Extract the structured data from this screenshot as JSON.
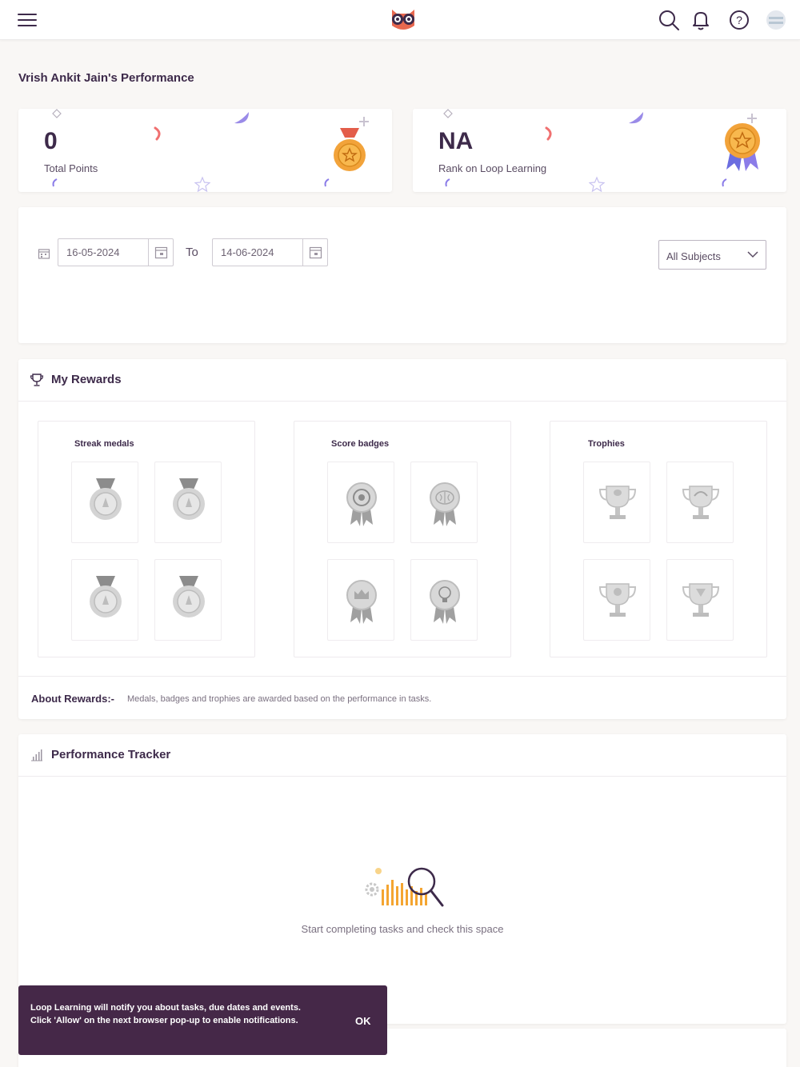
{
  "header": {
    "menu_icon": "hamburger-icon",
    "logo_icon": "owl-logo-icon",
    "actions": [
      "search-icon",
      "bell-icon",
      "help-icon",
      "avatar"
    ]
  },
  "page": {
    "title": "Vrish Ankit Jain's  Performance"
  },
  "stats": [
    {
      "value": "0",
      "label": "Total Points",
      "icon": "medal-icon"
    },
    {
      "value": "NA",
      "label": "Rank on Loop Learning",
      "icon": "rosette-icon"
    }
  ],
  "filters": {
    "calendar_icon": "calendar-icon",
    "from_date": "16-05-2024",
    "to_label": "To",
    "to_date": "14-06-2024",
    "subject": "All Subjects"
  },
  "rewards": {
    "title": "My Rewards",
    "panels": [
      {
        "title": "Streak medals",
        "items": [
          "medal-icon",
          "medal-icon",
          "medal-icon",
          "medal-icon"
        ]
      },
      {
        "title": "Score badges",
        "items": [
          "target-badge-icon",
          "brain-badge-icon",
          "crown-badge-icon",
          "bulb-badge-icon"
        ]
      },
      {
        "title": "Trophies",
        "items": [
          "trophy-icon",
          "trophy-icon",
          "trophy-icon",
          "trophy-icon"
        ]
      }
    ],
    "about_label": "About Rewards:-",
    "about_text": "Medals, badges and trophies are awarded based on the performance in tasks."
  },
  "tracker": {
    "title": "Performance Tracker",
    "empty_text": "Start completing tasks and check this space"
  },
  "toast": {
    "message": "Loop Learning will notify you about tasks, due dates and events. Click 'Allow' on the next browser pop-up to enable notifications.",
    "ok_label": "OK"
  },
  "colors": {
    "primary": "#3d2a4a",
    "toast_bg": "#452848",
    "accent_orange": "#f4a531",
    "accent_red": "#e35d4a",
    "accent_purple": "#8b7ce8"
  }
}
